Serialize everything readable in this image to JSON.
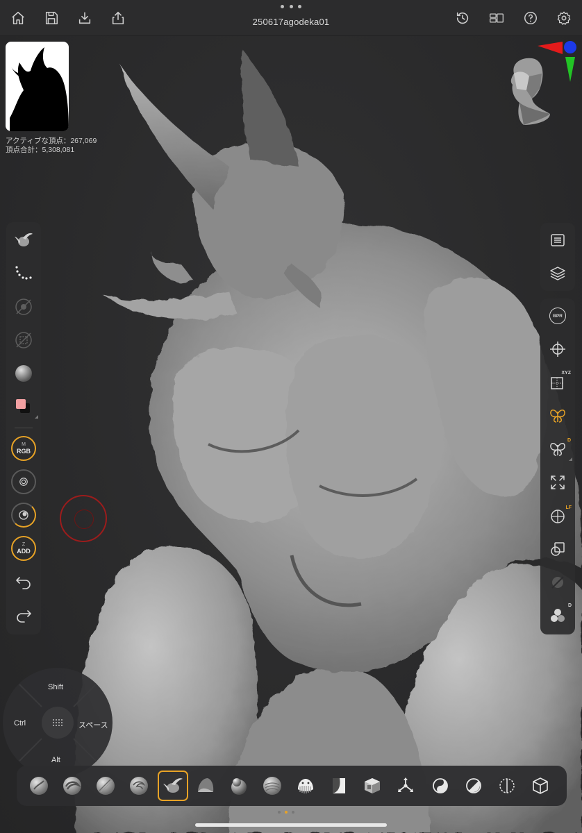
{
  "app": {
    "document_title": "250617agodeka01"
  },
  "stats": {
    "active_points": "アクティブな頂点：267,069",
    "total_points": "頂点合計：5,308,081"
  },
  "left_tools": {
    "material_label_small": "M",
    "material_label_big": "RGB",
    "z_label_small": "Z",
    "z_label_big": "ADD"
  },
  "right_tools": {
    "bpr_label": "BPR",
    "xyz_badge": "XYZ",
    "d_badge": "D",
    "lf_badge": "LF",
    "d2_badge": "D"
  },
  "modifier_pad": {
    "top": "Shift",
    "left": "Ctrl",
    "right": "スペース",
    "bottom": "Alt"
  },
  "colors": {
    "accent": "#e8a326",
    "primary_color_swatch": "#f2a0a2",
    "secondary_color_swatch": "#111111",
    "gizmo_x": "#e31b1b",
    "gizmo_y": "#22c425",
    "gizmo_z": "#1c39e8",
    "brush_cursor": "#9c1c1c"
  },
  "brushes": [
    {
      "name": "standard-brush-icon",
      "selected": false
    },
    {
      "name": "clay-buildup-brush-icon",
      "selected": false
    },
    {
      "name": "dam-standard-brush-icon",
      "selected": false
    },
    {
      "name": "move-brush-icon",
      "selected": false
    },
    {
      "name": "snakehook-brush-icon",
      "selected": true
    },
    {
      "name": "trim-dynamic-brush-icon",
      "selected": false
    },
    {
      "name": "inflate-brush-icon",
      "selected": false
    },
    {
      "name": "smooth-brush-icon",
      "selected": false
    },
    {
      "name": "imm-brush-icon",
      "selected": false
    },
    {
      "name": "curve-brush-icon",
      "selected": false
    },
    {
      "name": "insert-cube-brush-icon",
      "selected": false
    },
    {
      "name": "transpose-brush-icon",
      "selected": false
    },
    {
      "name": "mask-brush-icon",
      "selected": false
    },
    {
      "name": "clip-brush-icon",
      "selected": false
    },
    {
      "name": "slice-brush-icon",
      "selected": false
    },
    {
      "name": "cube-select-brush-icon",
      "selected": false
    }
  ],
  "page_indicator": {
    "current": 2,
    "total": 3
  }
}
